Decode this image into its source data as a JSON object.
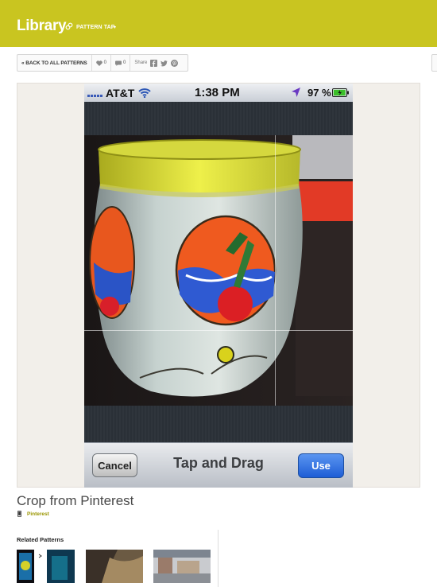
{
  "header": {
    "logo": "Library",
    "brand": "PATTERN TAP",
    "caret": "▾",
    "bg_color": "#c9c520"
  },
  "toolbar": {
    "back_label": "« BACK TO ALL PATTERNS",
    "likes": "0",
    "comments": "0",
    "share_label": "Share",
    "icons": [
      "heart-icon",
      "comment-icon",
      "facebook-icon",
      "twitter-icon",
      "pinterest-icon"
    ]
  },
  "phone": {
    "carrier": "AT&T",
    "time": "1:38 PM",
    "battery_pct": "97 %",
    "battery_level": 0.97,
    "cancel_label": "Cancel",
    "bar_title": "Tap and Drag",
    "use_label": "Use",
    "accent": "#1e5dd6"
  },
  "pattern": {
    "title": "Crop from Pinterest",
    "source": "Pinterest"
  },
  "related": {
    "heading": "Related Patterns"
  }
}
